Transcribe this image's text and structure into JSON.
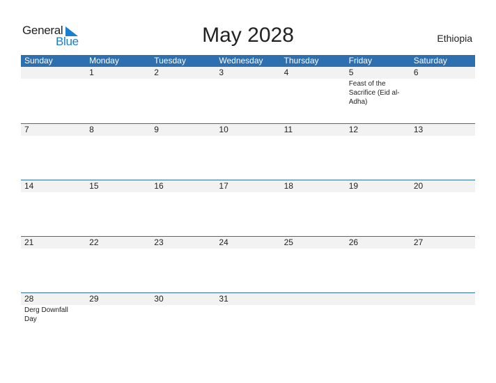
{
  "logo": {
    "line1": "General",
    "line2": "Blue"
  },
  "title": "May 2028",
  "country": "Ethiopia",
  "colors": {
    "header_bg": "#2e6fb0",
    "day_bar_bg": "#f2f2f2",
    "logo_blue": "#1a7fd0"
  },
  "weekdays": [
    "Sunday",
    "Monday",
    "Tuesday",
    "Wednesday",
    "Thursday",
    "Friday",
    "Saturday"
  ],
  "weeks": [
    [
      {
        "day": "",
        "event": ""
      },
      {
        "day": "1",
        "event": ""
      },
      {
        "day": "2",
        "event": ""
      },
      {
        "day": "3",
        "event": ""
      },
      {
        "day": "4",
        "event": ""
      },
      {
        "day": "5",
        "event": "Feast of the Sacrifice (Eid al-Adha)"
      },
      {
        "day": "6",
        "event": ""
      }
    ],
    [
      {
        "day": "7",
        "event": ""
      },
      {
        "day": "8",
        "event": ""
      },
      {
        "day": "9",
        "event": ""
      },
      {
        "day": "10",
        "event": ""
      },
      {
        "day": "11",
        "event": ""
      },
      {
        "day": "12",
        "event": ""
      },
      {
        "day": "13",
        "event": ""
      }
    ],
    [
      {
        "day": "14",
        "event": ""
      },
      {
        "day": "15",
        "event": ""
      },
      {
        "day": "16",
        "event": ""
      },
      {
        "day": "17",
        "event": ""
      },
      {
        "day": "18",
        "event": ""
      },
      {
        "day": "19",
        "event": ""
      },
      {
        "day": "20",
        "event": ""
      }
    ],
    [
      {
        "day": "21",
        "event": ""
      },
      {
        "day": "22",
        "event": ""
      },
      {
        "day": "23",
        "event": ""
      },
      {
        "day": "24",
        "event": ""
      },
      {
        "day": "25",
        "event": ""
      },
      {
        "day": "26",
        "event": ""
      },
      {
        "day": "27",
        "event": ""
      }
    ],
    [
      {
        "day": "28",
        "event": "Derg Downfall Day"
      },
      {
        "day": "29",
        "event": ""
      },
      {
        "day": "30",
        "event": ""
      },
      {
        "day": "31",
        "event": ""
      },
      {
        "day": "",
        "event": ""
      },
      {
        "day": "",
        "event": ""
      },
      {
        "day": "",
        "event": ""
      }
    ]
  ]
}
